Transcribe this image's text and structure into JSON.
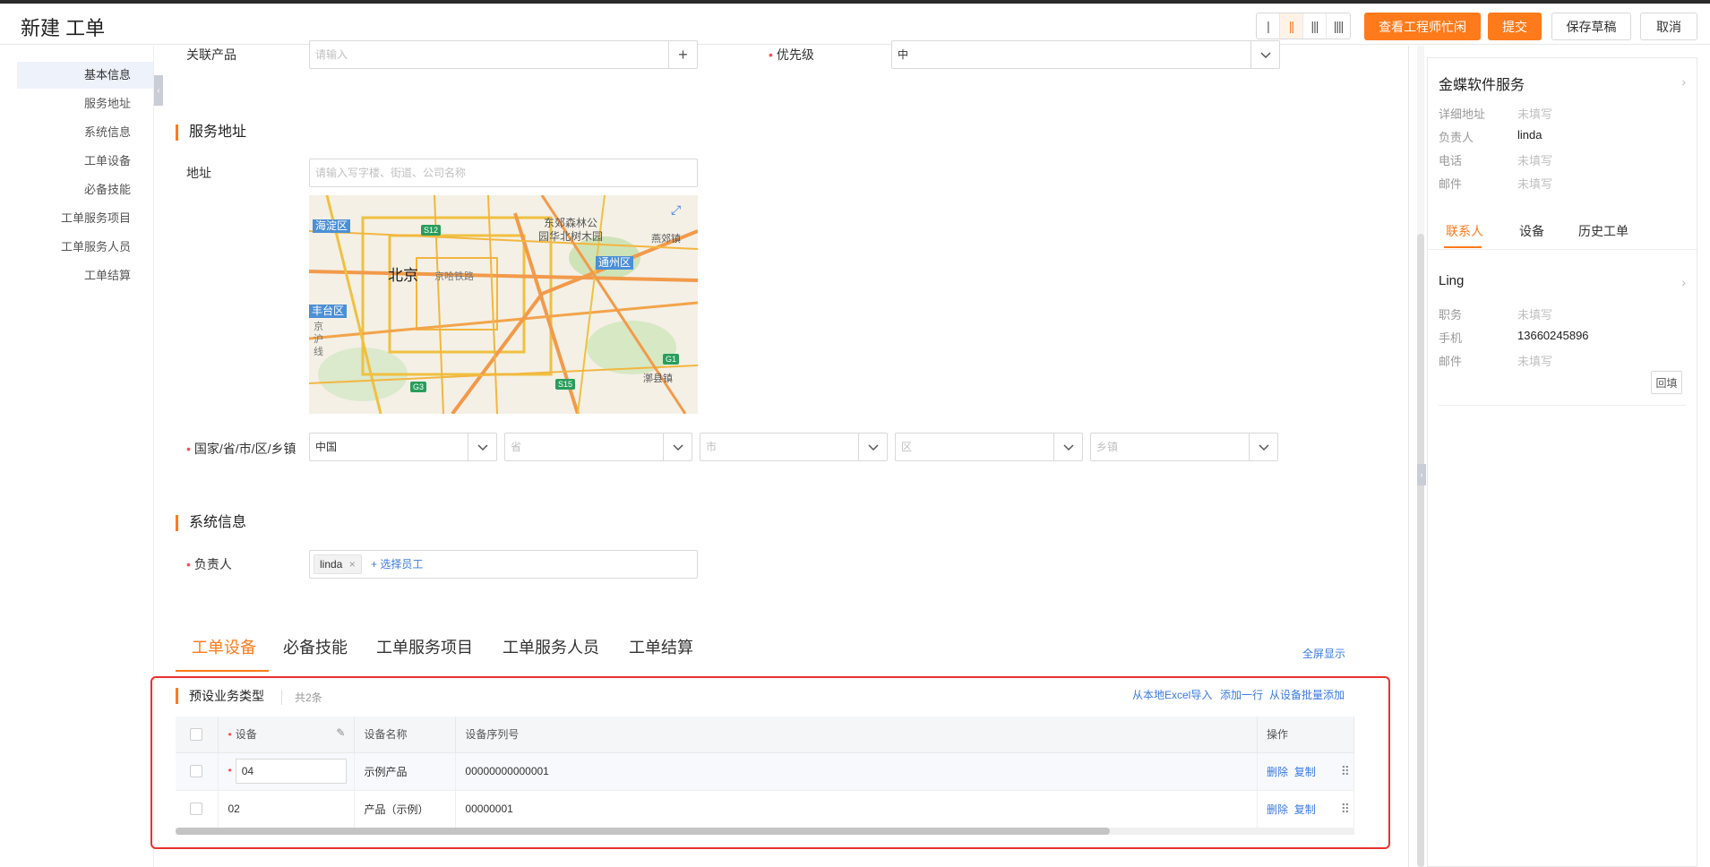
{
  "header": {
    "title": "新建 工单",
    "layout_switch": [
      "|",
      "||",
      "|||",
      "||||"
    ],
    "buttons": {
      "engineer_busy": "查看工程师忙闲",
      "submit": "提交",
      "save_draft": "保存草稿",
      "cancel": "取消"
    }
  },
  "sidebar": {
    "items": [
      {
        "label": "基本信息"
      },
      {
        "label": "服务地址"
      },
      {
        "label": "系统信息"
      },
      {
        "label": "工单设备"
      },
      {
        "label": "必备技能"
      },
      {
        "label": "工单服务项目"
      },
      {
        "label": "工单服务人员"
      },
      {
        "label": "工单结算"
      }
    ]
  },
  "form": {
    "related_product_label": "关联产品",
    "related_product_placeholder": "请输入",
    "priority_label": "优先级",
    "priority_value": "中",
    "service_address_title": "服务地址",
    "address_label": "地址",
    "address_placeholder": "请输入写字楼、街道、公司名称",
    "region_label": "国家/省/市/区/乡镇",
    "country_value": "中国",
    "province_placeholder": "省",
    "city_placeholder": "市",
    "district_placeholder": "区",
    "town_placeholder": "乡镇",
    "system_info_title": "系统信息",
    "owner_label": "负责人",
    "owner_tag": "linda",
    "select_employee": "+ 选择员工"
  },
  "map": {
    "city": "北京",
    "areas": [
      "海淀区",
      "通州区",
      "丰台区"
    ],
    "places": [
      "东郊森林公",
      "园华北树木园",
      "燕郊镇",
      "漷县镇",
      "京哈铁路",
      "京沪线"
    ],
    "roads": [
      "S12",
      "G1",
      "G3",
      "S15"
    ]
  },
  "tabs": {
    "items": [
      "工单设备",
      "必备技能",
      "工单服务项目",
      "工单服务人员",
      "工单结算"
    ],
    "fullscreen": "全屏显示"
  },
  "device_table": {
    "title": "预设业务类型",
    "count": "共2条",
    "actions": {
      "import_excel": "从本地Excel导入",
      "add_row": "添加一行",
      "batch_add": "从设备批量添加"
    },
    "columns": [
      "设备",
      "设备名称",
      "设备序列号",
      "操作"
    ],
    "rows": [
      {
        "device": "04",
        "name": "示例产品",
        "serial": "00000000000001",
        "delete": "删除",
        "copy": "复制"
      },
      {
        "device": "02",
        "name": "产品（示例）",
        "serial": "00000001",
        "delete": "删除",
        "copy": "复制"
      }
    ]
  },
  "right_panel": {
    "customer": {
      "name": "金蝶软件服务",
      "fields": [
        {
          "key": "详细地址",
          "value": "未填写"
        },
        {
          "key": "负责人",
          "value": "linda"
        },
        {
          "key": "电话",
          "value": "未填写"
        },
        {
          "key": "邮件",
          "value": "未填写"
        }
      ]
    },
    "tabs": [
      "联系人",
      "设备",
      "历史工单"
    ],
    "contact": {
      "name": "Ling",
      "fields": [
        {
          "key": "职务",
          "value": "未填写"
        },
        {
          "key": "手机",
          "value": "13660245896"
        },
        {
          "key": "邮件",
          "value": "未填写"
        }
      ],
      "backfill_button": "回填"
    }
  },
  "colors": {
    "accent": "#ff7a1a",
    "link": "#3a7ae0",
    "highlight_box": "#e8322f"
  }
}
